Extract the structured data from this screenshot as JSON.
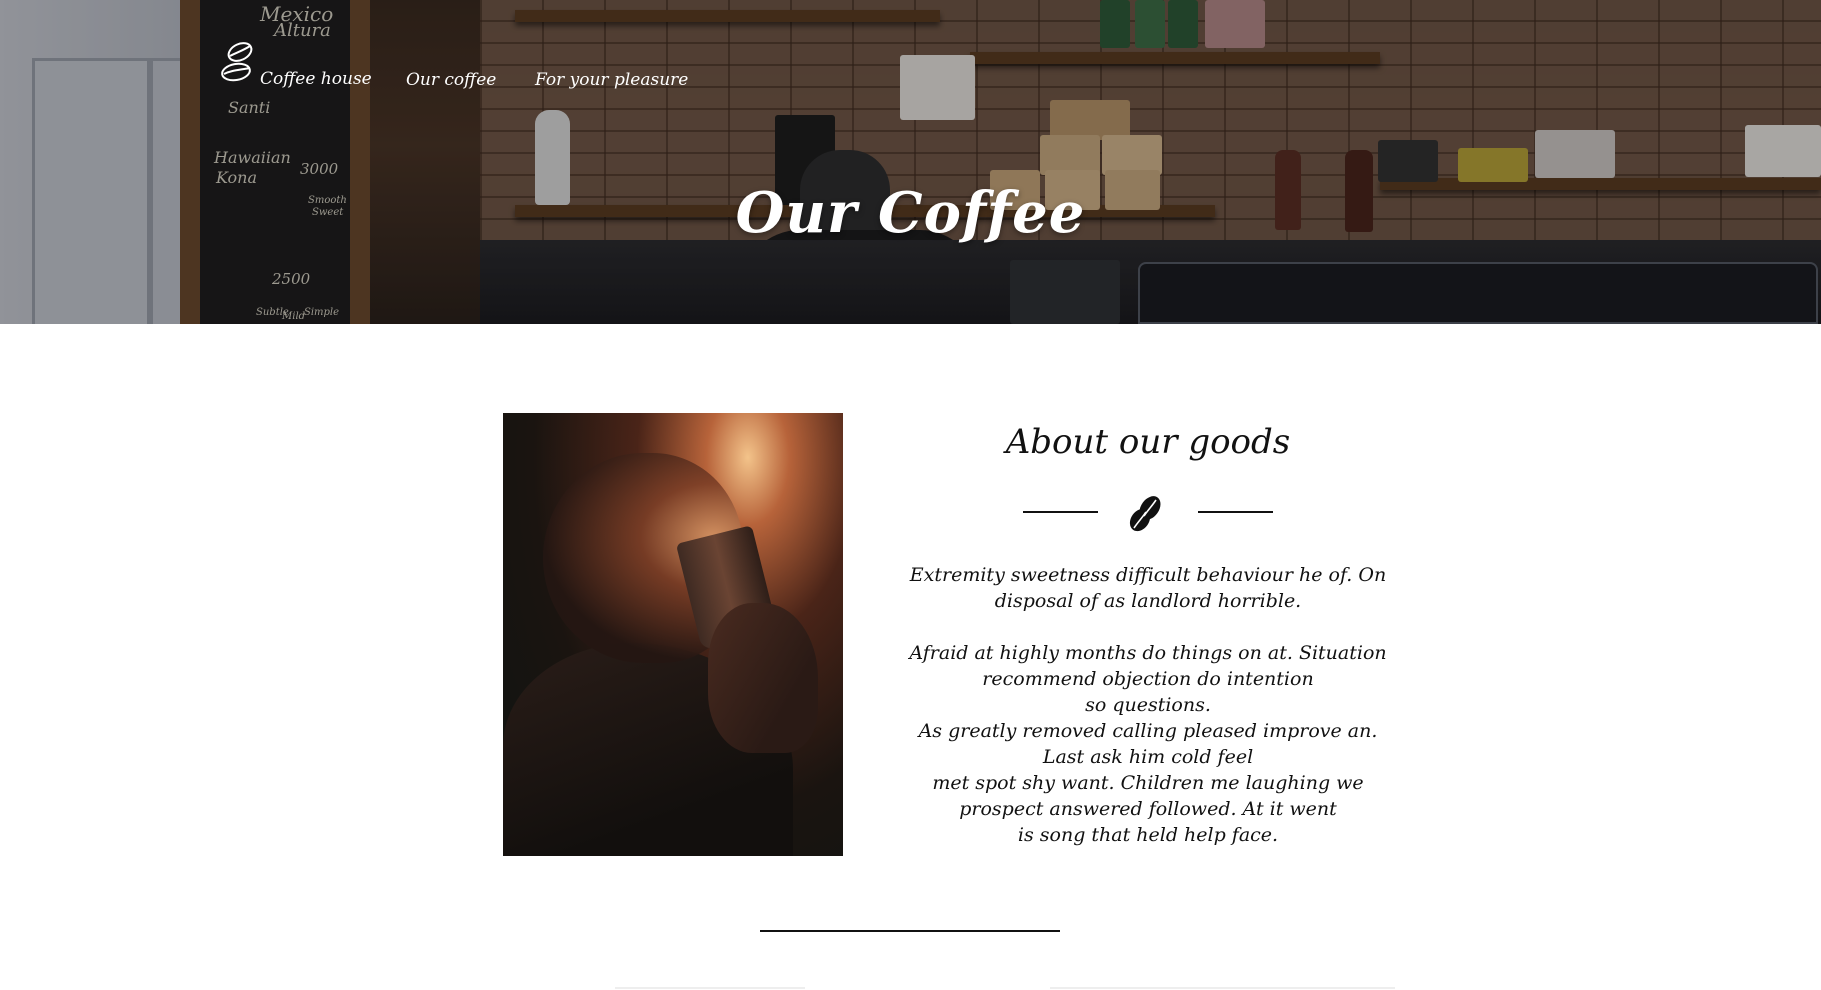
{
  "nav": {
    "logo_label": "Coffee house",
    "links": [
      {
        "label": "Our coffee"
      },
      {
        "label": "For your pleasure"
      }
    ]
  },
  "hero": {
    "title": "Our Coffee",
    "chalkboard": {
      "lines": [
        "Mexico",
        "Altura",
        "Santi",
        "Hawaiian",
        "Kona",
        "3000",
        "2500",
        "Smooth",
        "Sweet",
        "Subtle",
        "Mild",
        "Simple"
      ]
    }
  },
  "about": {
    "title": "About our goods",
    "icon": "coffee-beans-icon",
    "paragraph1": [
      "Extremity sweetness difficult behaviour he of. On",
      "disposal of as landlord horrible."
    ],
    "paragraph2": [
      "Afraid at highly months do things on at. Situation",
      "recommend objection do intention",
      "so questions.",
      "As greatly removed calling pleased improve an.",
      "Last ask him cold feel",
      "met spot shy want. Children me laughing we",
      "prospect answered followed. At it went",
      "is song that held help face."
    ]
  },
  "colors": {
    "text": "#111111",
    "nav_text": "#ffffff",
    "background": "#ffffff"
  }
}
